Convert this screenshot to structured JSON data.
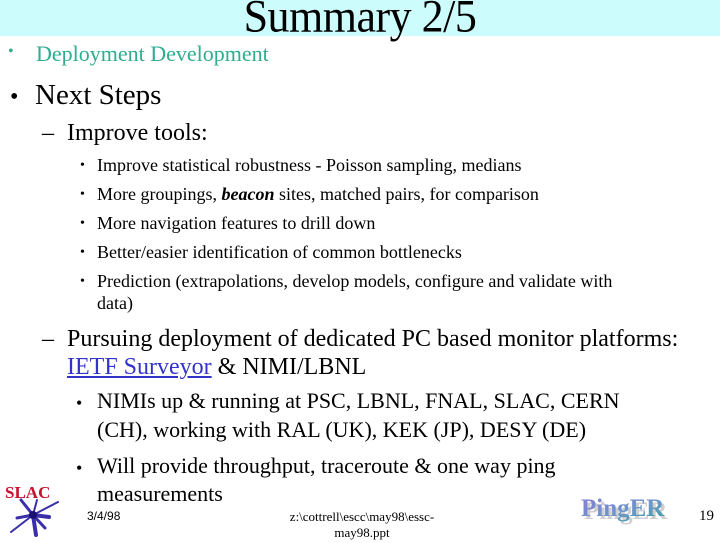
{
  "slide": {
    "title": "Summary 2/5",
    "breadcrumb_bullet": "Deployment Development",
    "heading": "Next Steps",
    "sections": [
      {
        "label": "Improve tools:",
        "items": [
          {
            "text": "Improve statistical robustness - Poisson sampling, medians"
          },
          {
            "pre": "More groupings, ",
            "emph": "beacon",
            "post": " sites, matched pairs, for comparison"
          },
          {
            "text": "More  navigation features to drill down"
          },
          {
            "text": "Better/easier identification of common bottlenecks"
          },
          {
            "line1": "Prediction (extrapolations, develop models, configure and validate with",
            "line2": "data)"
          }
        ]
      },
      {
        "label_line1": "Pursuing deployment of dedicated PC based monitor platforms:",
        "link_text": "IETF Surveyor",
        "label_line2_rest": " & NIMI/LBNL",
        "items": [
          {
            "line1": "NIMIs up & running at PSC, LBNL, FNAL, SLAC, CERN",
            "line2": "(CH), working with  RAL (UK), KEK (JP), DESY (DE)"
          },
          {
            "line1": "Will provide throughput, traceroute & one way ping",
            "line2": "measurements"
          }
        ]
      }
    ]
  },
  "footer": {
    "date": "3/4/98",
    "path_line1": "z:\\cottrell\\escc\\may98\\essc-",
    "path_line2": "may98.ppt",
    "page_number": "19",
    "logo_left": "SLAC",
    "logo_right": "PingER"
  },
  "colors": {
    "title_band": "#ccfcfc",
    "breadcrumb": "#2eae8e",
    "link": "#3333cc",
    "slac_red": "#c8102e"
  }
}
